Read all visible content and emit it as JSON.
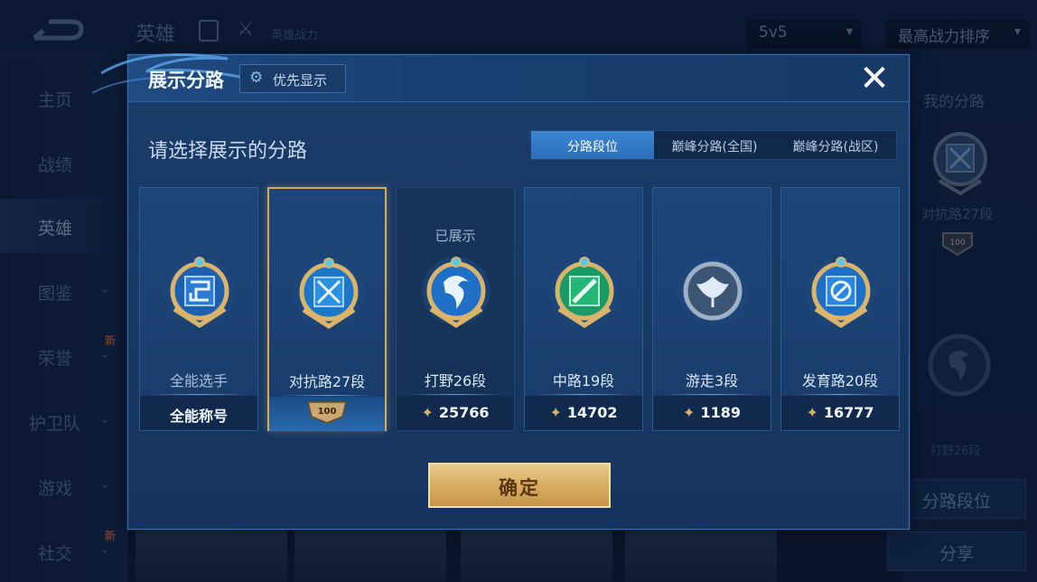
{
  "background": {
    "title": "英雄",
    "power_label": "英雄战力",
    "mode_select": "5v5",
    "sort_select": "最高战力排序",
    "sidebar": [
      {
        "label": "主页"
      },
      {
        "label": "战绩"
      },
      {
        "label": "英雄",
        "active": true
      },
      {
        "label": "图鉴",
        "chevron": true
      },
      {
        "label": "荣誉",
        "chevron": true,
        "new": "新"
      },
      {
        "label": "护卫队",
        "chevron": true
      },
      {
        "label": "游戏",
        "chevron": true
      },
      {
        "label": "社交",
        "chevron": true,
        "new": "新"
      }
    ],
    "right_panel": {
      "my_lane": "我的分路",
      "current_rank": "对抗路27段",
      "badge": "100",
      "secondary_rank": "打野26段",
      "lane_rank_button": "分路段位",
      "share_button": "分享"
    }
  },
  "modal": {
    "title": "展示分路",
    "priority_button": "优先显示",
    "close_icon": "close-icon",
    "subtitle": "请选择展示的分路",
    "tabs": [
      {
        "label": "分路段位",
        "active": true
      },
      {
        "label": "巅峰分路(全国)",
        "active": false
      },
      {
        "label": "巅峰分路(战区)",
        "active": false
      }
    ],
    "cards": [
      {
        "rank": "全能选手",
        "bottom": "全能称号",
        "displayed": "",
        "medal": "all-round-medal-icon",
        "color": "#2a6fd1"
      },
      {
        "rank": "对抗路27段",
        "bottom": "100",
        "displayed": "",
        "medal": "clash-lane-medal-icon",
        "color": "#1c8fd8",
        "selected": true
      },
      {
        "rank": "打野26段",
        "bottom": "25766",
        "displayed": "已展示",
        "medal": "jungle-medal-icon",
        "color": "#2a6fd1"
      },
      {
        "rank": "中路19段",
        "bottom": "14702",
        "displayed": "",
        "medal": "mid-lane-medal-icon",
        "color": "#1fa86a"
      },
      {
        "rank": "游走3段",
        "bottom": "1189",
        "displayed": "",
        "medal": "roam-medal-icon",
        "color": "#6a7f9b"
      },
      {
        "rank": "发育路20段",
        "bottom": "16777",
        "displayed": "",
        "medal": "farm-lane-medal-icon",
        "color": "#2a6fd1"
      }
    ],
    "confirm_button": "确定"
  }
}
